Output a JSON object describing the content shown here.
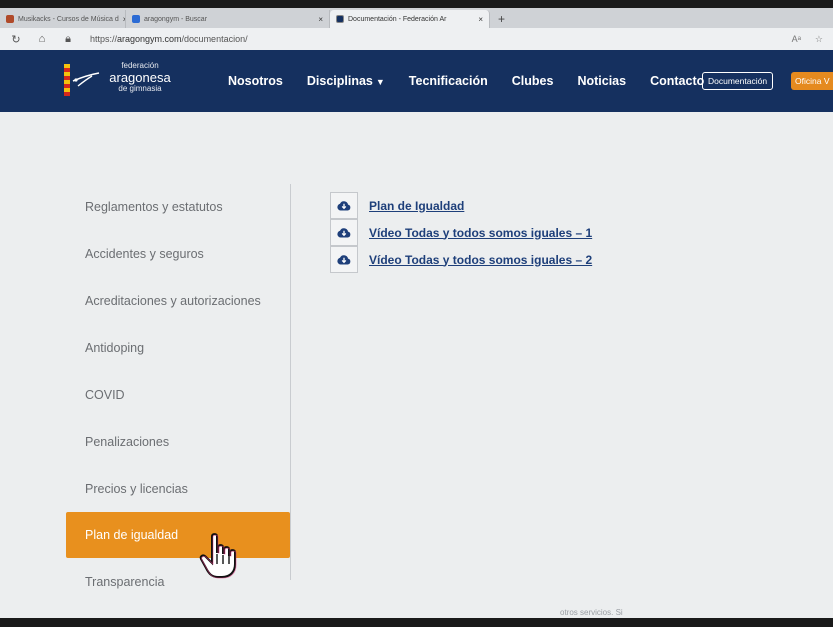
{
  "browser": {
    "tabs": [
      {
        "title": "Musikacks - Cursos de Música d",
        "close": "×",
        "color": "#b04a2a"
      },
      {
        "title": "aragongym - Buscar",
        "close": "×",
        "color": "#2b6bd4"
      },
      {
        "title": "Documentación - Federación Ar",
        "close": "×",
        "color": "#15305f"
      }
    ],
    "new_tab": "+",
    "url_prefix": "https://",
    "url_host": "aragongym.com",
    "url_path": "/documentacion/"
  },
  "header": {
    "logo": {
      "line1": "federación",
      "line2": "aragonesa",
      "line3": "de gimnasia"
    },
    "nav": [
      {
        "label": "Nosotros",
        "caret": ""
      },
      {
        "label": "Disciplinas",
        "caret": "▼"
      },
      {
        "label": "Tecnificación",
        "caret": ""
      },
      {
        "label": "Clubes",
        "caret": ""
      },
      {
        "label": "Noticias",
        "caret": ""
      },
      {
        "label": "Contacto",
        "caret": ""
      }
    ],
    "documentacion_button": "Documentación",
    "oficina_button": "Oficina V"
  },
  "sidebar": {
    "items": [
      {
        "label": "Reglamentos y estatutos",
        "active": false
      },
      {
        "label": "Accidentes y seguros",
        "active": false
      },
      {
        "label": "Acreditaciones y autorizaciones",
        "active": false
      },
      {
        "label": "Antidoping",
        "active": false
      },
      {
        "label": "COVID",
        "active": false
      },
      {
        "label": "Penalizaciones",
        "active": false
      },
      {
        "label": "Precios y licencias",
        "active": false
      },
      {
        "label": "Plan de igualdad",
        "active": true
      },
      {
        "label": "Transparencia",
        "active": false
      }
    ]
  },
  "documents": [
    {
      "label": "Plan de Igualdad",
      "icon": "cloud-download-icon"
    },
    {
      "label": "Vídeo Todas y todos somos iguales – 1",
      "icon": "cloud-download-icon"
    },
    {
      "label": "Vídeo Todas y todos somos iguales – 2",
      "icon": "cloud-download-icon"
    }
  ],
  "footer_text": "otros servicios. Si",
  "colors": {
    "header_bg": "#15305f",
    "accent": "#e8901e",
    "link": "#1e3f7a"
  }
}
